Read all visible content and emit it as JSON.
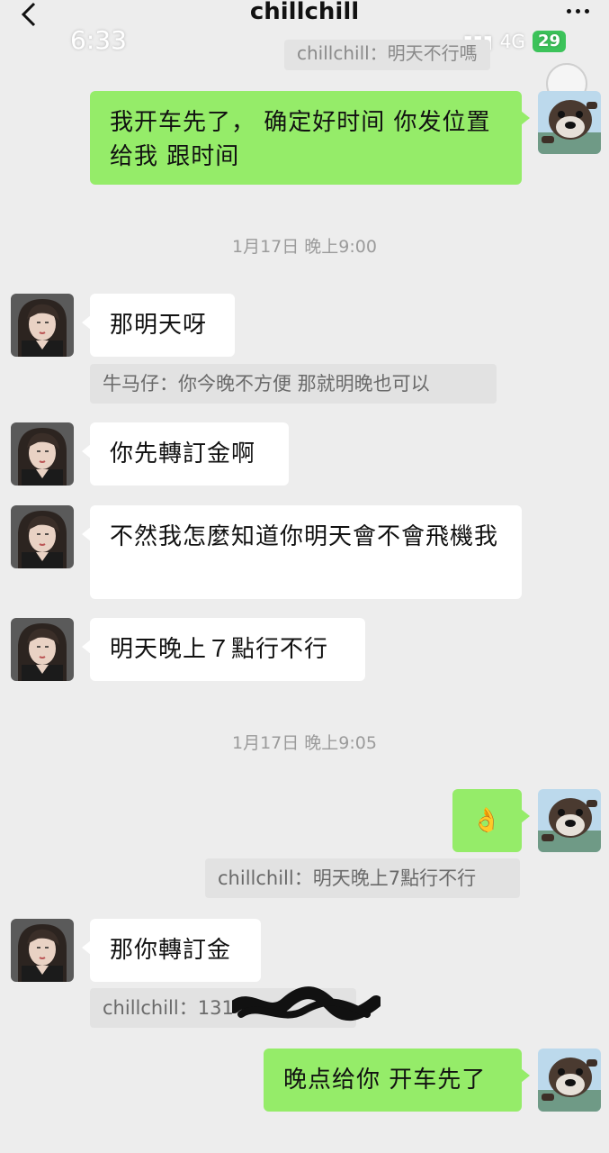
{
  "header": {
    "title": "chillchill",
    "back_icon": "chevron-left-icon",
    "more_icon": "more-dots-icon"
  },
  "status_bar": {
    "time": "6:33",
    "network": "4G",
    "battery": "29"
  },
  "ghost_message": "chillchill：明天不行嗎",
  "messages": [
    {
      "id": "m1",
      "side": "out",
      "text": "我开车先了， 确定好时间 你发位置给我 跟时间"
    },
    {
      "id": "t1",
      "type": "timestamp",
      "text": "1月17日 晚上9:00"
    },
    {
      "id": "m2",
      "side": "in",
      "text": "那明天呀",
      "quote": "牛马仔：你今晚不方便 那就明晚也可以"
    },
    {
      "id": "m3",
      "side": "in",
      "text": "你先轉訂金啊"
    },
    {
      "id": "m4",
      "side": "in",
      "text": "不然我怎麼知道你明天會不會飛機我"
    },
    {
      "id": "m5",
      "side": "in",
      "text": "明天晚上７點行不行"
    },
    {
      "id": "t2",
      "type": "timestamp",
      "text": "1月17日 晚上9:05"
    },
    {
      "id": "m6",
      "side": "out",
      "text": "👌",
      "quote": "chillchill：明天晚上7點行不行"
    },
    {
      "id": "m7",
      "side": "in",
      "text": "那你轉訂金",
      "quote": "chillchill：131"
    },
    {
      "id": "m8",
      "side": "out",
      "text": "晚点给你 开车先了"
    }
  ],
  "colors": {
    "background": "#ededed",
    "outgoing_bubble": "#95ec69",
    "incoming_bubble": "#ffffff",
    "quote_bg": "#e2e2e2"
  }
}
